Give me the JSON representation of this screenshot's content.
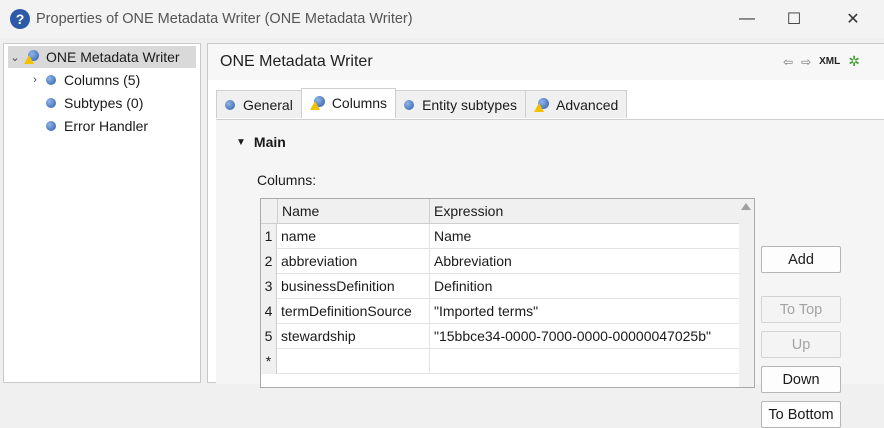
{
  "window": {
    "title": "Properties of ONE Metadata Writer (ONE Metadata Writer)",
    "minimize": "—",
    "maximize": "☐",
    "close": "✕"
  },
  "tree": {
    "root": "ONE Metadata Writer",
    "items": [
      {
        "label": "Columns (5)"
      },
      {
        "label": "Subtypes (0)"
      },
      {
        "label": "Error Handler"
      }
    ]
  },
  "panel": {
    "title": "ONE Metadata Writer",
    "tools": {
      "back": "⇦",
      "forward": "⇨",
      "xml": "XML",
      "debug": "✲"
    },
    "tabs": [
      {
        "label": "General",
        "icon": "blue-dot-icon"
      },
      {
        "label": "Columns",
        "icon": "warning-dot-icon"
      },
      {
        "label": "Entity subtypes",
        "icon": "blue-dot-icon"
      },
      {
        "label": "Advanced",
        "icon": "warning-dot-icon"
      }
    ],
    "section": "Main",
    "columns_label": "Columns:"
  },
  "table": {
    "headers": [
      "Name",
      "Expression"
    ],
    "rows": [
      {
        "num": "1",
        "name": "name",
        "expression": "Name"
      },
      {
        "num": "2",
        "name": "abbreviation",
        "expression": "Abbreviation"
      },
      {
        "num": "3",
        "name": "businessDefinition",
        "expression": "Definition"
      },
      {
        "num": "4",
        "name": "termDefinitionSource",
        "expression": "\"Imported terms\""
      },
      {
        "num": "5",
        "name": "stewardship",
        "expression": "\"15bbce34-0000-7000-0000-00000047025b\""
      },
      {
        "num": "*",
        "name": "",
        "expression": ""
      }
    ]
  },
  "buttons": {
    "add": "Add",
    "to_top": "To Top",
    "up": "Up",
    "down": "Down",
    "to_bottom": "To Bottom"
  }
}
